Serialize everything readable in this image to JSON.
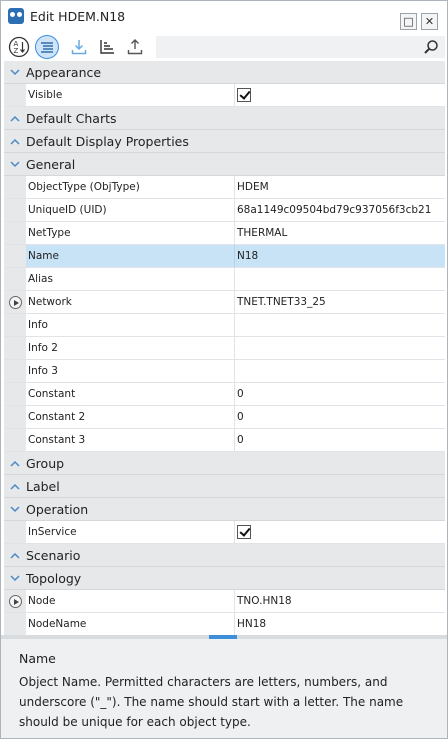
{
  "window": {
    "title": "Edit HDEM.N18",
    "maximize_glyph": "□",
    "close_glyph": "✕"
  },
  "toolbar": {
    "buttons": [
      "sort-alphabetical-icon",
      "categorized-icon",
      "import-icon",
      "tree-sort-icon",
      "export-icon"
    ],
    "search_placeholder": ""
  },
  "categories": {
    "appearance": "Appearance",
    "default_charts": "Default Charts",
    "default_display": "Default Display Properties",
    "general": "General",
    "group": "Group",
    "label": "Label",
    "operation": "Operation",
    "scenario": "Scenario",
    "topology": "Topology"
  },
  "appearance": {
    "visible": {
      "name": "Visible",
      "checked": true
    }
  },
  "general": [
    {
      "name": "ObjectType (ObjType)",
      "value": "HDEM"
    },
    {
      "name": "UniqueID (UID)",
      "value": "68a1149c09504bd79c937056f3cb21"
    },
    {
      "name": "NetType",
      "value": "THERMAL"
    },
    {
      "name": "Name",
      "value": "N18"
    },
    {
      "name": "Alias",
      "value": ""
    },
    {
      "name": "Network",
      "value": "TNET.TNET33_25"
    },
    {
      "name": "Info",
      "value": ""
    },
    {
      "name": "Info 2",
      "value": ""
    },
    {
      "name": "Info 3",
      "value": ""
    },
    {
      "name": "Constant",
      "value": "0"
    },
    {
      "name": "Constant 2",
      "value": "0"
    },
    {
      "name": "Constant 3",
      "value": "0"
    }
  ],
  "operation": {
    "inservice": {
      "name": "InService",
      "checked": true
    }
  },
  "topology": [
    {
      "name": "Node",
      "value": "TNO.HN18"
    },
    {
      "name": "NodeName",
      "value": "HN18"
    }
  ],
  "description": {
    "title": "Name",
    "text": "Object Name. Permitted characters are letters, numbers, and underscore (\"_\"). The name should start with a letter. The name should be unique for each object type."
  },
  "colors": {
    "accent": "#3c8fd8",
    "selection": "#c8e3f5",
    "category_bg": "#e6e8ea"
  }
}
